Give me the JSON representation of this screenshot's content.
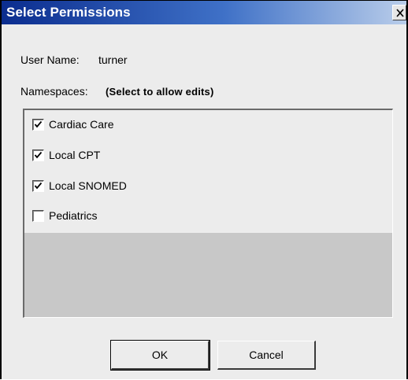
{
  "window": {
    "title": "Select Permissions",
    "close_label": "X"
  },
  "form": {
    "user_name_label": "User Name:",
    "user_name_value": "turner",
    "namespaces_label": "Namespaces:",
    "namespaces_hint": "(Select to allow edits)"
  },
  "namespaces": [
    {
      "label": "Cardiac Care",
      "checked": true
    },
    {
      "label": "Local CPT",
      "checked": true
    },
    {
      "label": "Local SNOMED",
      "checked": true
    },
    {
      "label": "Pediatrics",
      "checked": false
    }
  ],
  "buttons": {
    "ok_label": "OK",
    "cancel_label": "Cancel"
  },
  "colors": {
    "titlebar_start": "#0b2d8f",
    "titlebar_end": "#b9cdea",
    "dialog_background": "#ececec",
    "list_empty_area": "#c8c8c8"
  },
  "icons": {
    "close": "close-icon",
    "check": "checkmark-icon"
  }
}
